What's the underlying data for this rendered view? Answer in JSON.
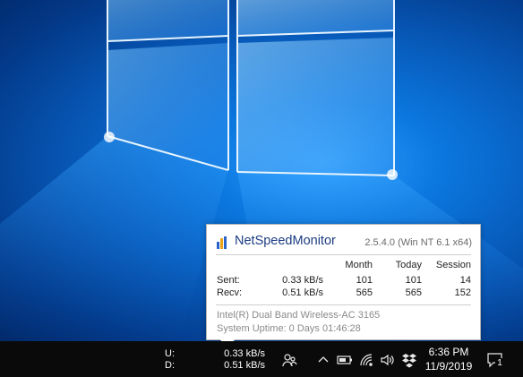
{
  "taskbar": {
    "upload_label": "U:",
    "download_label": "D:",
    "upload_speed": "0.33 kB/s",
    "download_speed": "0.51 kB/s",
    "time": "6:36 PM",
    "date": "11/9/2019",
    "notification_count": "1"
  },
  "popup": {
    "title": "NetSpeedMonitor",
    "version": "2.5.4.0 (Win NT 6.1 x64)",
    "columns": [
      "Month",
      "Today",
      "Session"
    ],
    "rows": [
      {
        "label": "Sent:",
        "rate": "0.33 kB/s",
        "month": "101",
        "today": "101",
        "session": "14"
      },
      {
        "label": "Recv:",
        "rate": "0.51 kB/s",
        "month": "565",
        "today": "565",
        "session": "152"
      }
    ],
    "adapter": "Intel(R) Dual Band Wireless-AC 3165",
    "uptime": "System Uptime: 0 Days 01:46:28"
  }
}
